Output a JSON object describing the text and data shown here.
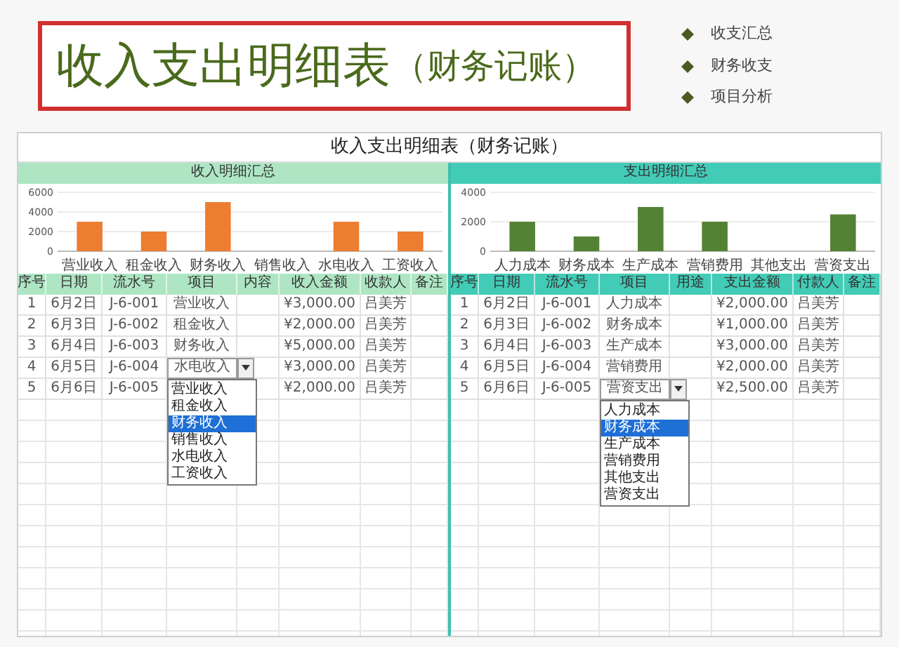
{
  "banner": {
    "title": "收入支出明细表",
    "subtitle": "（财务记账）",
    "bullets": [
      "收支汇总",
      "财务收支",
      "项目分析"
    ]
  },
  "sheet": {
    "title": "收入支出明细表（财务记账）",
    "panels": [
      {
        "kind": "income",
        "title": "收入明细汇总",
        "chart_data": {
          "type": "bar",
          "categories": [
            "营业收入",
            "租金收入",
            "财务收入",
            "销售收入",
            "水电收入",
            "工资收入"
          ],
          "series": [
            {
              "color": "#ed7d31",
              "values": [
                3000,
                2000,
                5000,
                0,
                3000,
                2000
              ]
            }
          ],
          "ylim": [
            0,
            6000
          ],
          "yticks": [
            0,
            2000,
            4000,
            6000
          ]
        },
        "columns": [
          "序号",
          "日期",
          "流水号",
          "项目",
          "内容",
          "收入金额",
          "收款人",
          "备注"
        ],
        "rows": [
          {
            "no": "1",
            "date": "6月2日",
            "serial": "J-6-001",
            "item": "营业收入",
            "amount": "¥3,000.00",
            "person": "吕美芳",
            "dropdown_open": false
          },
          {
            "no": "2",
            "date": "6月3日",
            "serial": "J-6-002",
            "item": "租金收入",
            "amount": "¥2,000.00",
            "person": "吕美芳",
            "dropdown_open": false
          },
          {
            "no": "3",
            "date": "6月4日",
            "serial": "J-6-003",
            "item": "财务收入",
            "amount": "¥5,000.00",
            "person": "吕美芳",
            "dropdown_open": false
          },
          {
            "no": "4",
            "date": "6月5日",
            "serial": "J-6-004",
            "item": "水电收入",
            "amount": "¥3,000.00",
            "person": "吕美芳",
            "dropdown_open": true
          },
          {
            "no": "5",
            "date": "6月6日",
            "serial": "J-6-005",
            "amount": "¥2,000.00",
            "person": "吕美芳",
            "dropdown_open": false
          }
        ],
        "dropdown_options": [
          {
            "label": "营业收入",
            "selected": false
          },
          {
            "label": "租金收入",
            "selected": false
          },
          {
            "label": "财务收入",
            "selected": true
          },
          {
            "label": "销售收入",
            "selected": false
          },
          {
            "label": "水电收入",
            "selected": false
          },
          {
            "label": "工资收入",
            "selected": false
          }
        ]
      },
      {
        "kind": "expense",
        "title": "支出明细汇总",
        "chart_data": {
          "type": "bar",
          "categories": [
            "人力成本",
            "财务成本",
            "生产成本",
            "营销费用",
            "其他支出",
            "营资支出"
          ],
          "series": [
            {
              "color": "#548235",
              "values": [
                2000,
                1000,
                3000,
                2000,
                0,
                2500
              ]
            }
          ],
          "ylim": [
            0,
            4000
          ],
          "yticks": [
            0,
            2000,
            4000
          ]
        },
        "columns": [
          "序号",
          "日期",
          "流水号",
          "项目",
          "用途",
          "支出金额",
          "付款人",
          "备注"
        ],
        "rows": [
          {
            "no": "1",
            "date": "6月2日",
            "serial": "J-6-001",
            "item": "人力成本",
            "amount": "¥2,000.00",
            "person": "吕美芳",
            "dropdown_open": false
          },
          {
            "no": "2",
            "date": "6月3日",
            "serial": "J-6-002",
            "item": "财务成本",
            "amount": "¥1,000.00",
            "person": "吕美芳",
            "dropdown_open": false
          },
          {
            "no": "3",
            "date": "6月4日",
            "serial": "J-6-003",
            "item": "生产成本",
            "amount": "¥3,000.00",
            "person": "吕美芳",
            "dropdown_open": false
          },
          {
            "no": "4",
            "date": "6月5日",
            "serial": "J-6-004",
            "item": "营销费用",
            "amount": "¥2,000.00",
            "person": "吕美芳",
            "dropdown_open": false
          },
          {
            "no": "5",
            "date": "6月6日",
            "serial": "J-6-005",
            "item": "营资支出",
            "amount": "¥2,500.00",
            "person": "吕美芳",
            "dropdown_open": true
          }
        ],
        "dropdown_options": [
          {
            "label": "人力成本",
            "selected": false
          },
          {
            "label": "财务成本",
            "selected": true
          },
          {
            "label": "生产成本",
            "selected": false
          },
          {
            "label": "营销费用",
            "selected": false
          },
          {
            "label": "其他支出",
            "selected": false
          },
          {
            "label": "营资支出",
            "selected": false
          }
        ]
      }
    ]
  }
}
